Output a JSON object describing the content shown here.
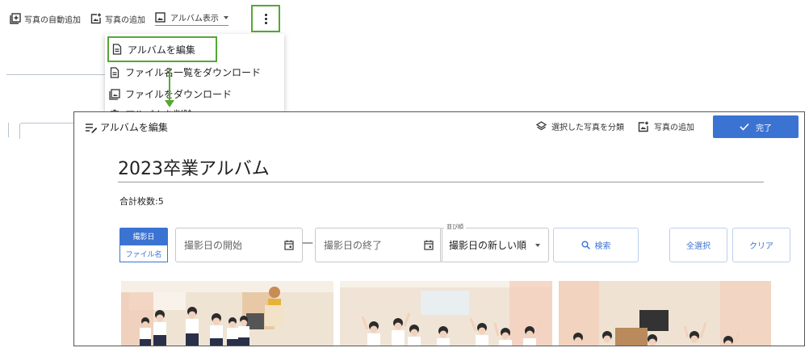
{
  "toolbar": {
    "auto_add_label": "写真の自動追加",
    "add_photo_label": "写真の追加",
    "view_label": "アルバム表示"
  },
  "menu": {
    "items": [
      {
        "label": "アルバムを編集",
        "icon": "document-icon"
      },
      {
        "label": "ファイル名一覧をダウンロード",
        "icon": "document-icon"
      },
      {
        "label": "ファイルをダウンロード",
        "icon": "photo-library-icon"
      },
      {
        "label": "アルバムを削除",
        "icon": "trash-icon"
      }
    ]
  },
  "editor": {
    "title": "アルバムを編集",
    "classify_label": "選択した写真を分類",
    "add_photo_label": "写真の追加",
    "done_label": "完了",
    "album_title": "2023卒業アルバム",
    "count_text": "合計枚数:5",
    "filter": {
      "segment_active": "撮影日",
      "segment_inactive": "ファイル名",
      "start_placeholder": "撮影日の開始",
      "separator": "—",
      "end_placeholder": "撮影日の終了",
      "sort_label": "並び順",
      "sort_value": "撮影日の新しい順",
      "search_label": "検索",
      "select_all_label": "全選択",
      "clear_label": "クリア"
    },
    "photos": [
      {
        "name": "classroom-children-1"
      },
      {
        "name": "classroom-children-2"
      },
      {
        "name": "classroom-children-3"
      }
    ]
  },
  "colors": {
    "accent": "#3b73d3",
    "highlight": "#55a833"
  }
}
